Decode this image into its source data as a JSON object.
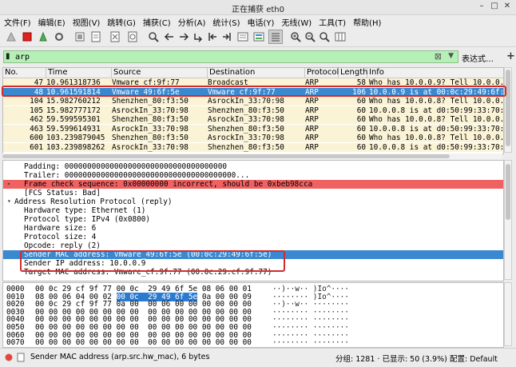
{
  "window": {
    "title": "正在捕获 eth0",
    "min": "–",
    "max": "□",
    "close": "✕"
  },
  "menu": [
    "文件(F)",
    "编辑(E)",
    "视图(V)",
    "跳转(G)",
    "捕获(C)",
    "分析(A)",
    "统计(S)",
    "电话(Y)",
    "无线(W)",
    "工具(T)",
    "帮助(H)"
  ],
  "toolbar_icons": [
    "shark-fin-icon",
    "stop-icon",
    "restart-icon",
    "options-gear-icon",
    "open-folder-icon",
    "save-file-icon",
    "close-file-icon",
    "reload-icon",
    "find-icon",
    "back-arrow-icon",
    "forward-arrow-icon",
    "goto-packet-icon",
    "first-packet-icon",
    "last-packet-icon",
    "autoscroll-icon",
    "colorize-icon",
    "zoom-in-icon",
    "zoom-out-icon",
    "zoom-normal-icon",
    "resize-columns-icon"
  ],
  "filter": {
    "value": "arp",
    "expression_label": "表达式…",
    "plus": "+"
  },
  "packet_list": {
    "columns": [
      "No.",
      "Time",
      "Source",
      "Destination",
      "Protocol",
      "Length",
      "Info"
    ],
    "rows": [
      {
        "no": "47",
        "time": "10.961318736",
        "src": "Vmware_cf:9f:77",
        "dst": "Broadcast",
        "proto": "ARP",
        "len": "58",
        "info": "Who has 10.0.0.9? Tell 10.0.0.",
        "style": "normal"
      },
      {
        "no": "48",
        "time": "10.961591814",
        "src": "Vmware_49:6f:5e",
        "dst": "Vmware_cf:9f:77",
        "proto": "ARP",
        "len": "106",
        "info": "10.0.0.9 is at 00:0c:29:49:6f:",
        "style": "selected"
      },
      {
        "no": "104",
        "time": "15.982760212",
        "src": "Shenzhen_80:f3:50",
        "dst": "AsrockIn_33:70:98",
        "proto": "ARP",
        "len": "60",
        "info": "Who has 10.0.0.8? Tell 10.0.0.",
        "style": "normal"
      },
      {
        "no": "105",
        "time": "15.982777172",
        "src": "AsrockIn_33:70:98",
        "dst": "Shenzhen_80:f3:50",
        "proto": "ARP",
        "len": "60",
        "info": "10.0.0.8 is at d0:50:99:33:70:",
        "style": "normal"
      },
      {
        "no": "462",
        "time": "59.599595301",
        "src": "Shenzhen_80:f3:50",
        "dst": "AsrockIn_33:70:98",
        "proto": "ARP",
        "len": "60",
        "info": "Who has 10.0.0.8? Tell 10.0.0.",
        "style": "normal"
      },
      {
        "no": "463",
        "time": "59.599614931",
        "src": "AsrockIn_33:70:98",
        "dst": "Shenzhen_80:f3:50",
        "proto": "ARP",
        "len": "60",
        "info": "10.0.0.8 is at d0:50:99:33:70:",
        "style": "normal"
      },
      {
        "no": "600",
        "time": "103.239879045",
        "src": "Shenzhen_80:f3:50",
        "dst": "AsrockIn_33:70:98",
        "proto": "ARP",
        "len": "60",
        "info": "Who has 10.0.0.8? Tell 10.0.0.",
        "style": "normal"
      },
      {
        "no": "601",
        "time": "103.239898262",
        "src": "AsrockIn_33:70:98",
        "dst": "Shenzhen_80:f3:50",
        "proto": "ARP",
        "len": "60",
        "info": "10.0.0.8 is at d0:50:99:33:70:",
        "style": "normal"
      }
    ]
  },
  "details": [
    {
      "text": "Padding: 000000000000000000000000000000000000",
      "indent": 1,
      "style": "normal"
    },
    {
      "text": "Trailer: 00000000000000000000000000000000000000...",
      "indent": 1,
      "style": "normal"
    },
    {
      "text": "Frame check sequence: 0x00000000 incorrect, should be 0xbeb98cca",
      "indent": 1,
      "style": "error",
      "arrow": "▸"
    },
    {
      "text": "[FCS Status: Bad]",
      "indent": 1,
      "style": "normal"
    },
    {
      "text": "Address Resolution Protocol (reply)",
      "indent": 0,
      "style": "normal",
      "arrow": "▾"
    },
    {
      "text": "Hardware type: Ethernet (1)",
      "indent": 1,
      "style": "normal"
    },
    {
      "text": "Protocol type: IPv4 (0x0800)",
      "indent": 1,
      "style": "normal"
    },
    {
      "text": "Hardware size: 6",
      "indent": 1,
      "style": "normal"
    },
    {
      "text": "Protocol size: 4",
      "indent": 1,
      "style": "normal"
    },
    {
      "text": "Opcode: reply (2)",
      "indent": 1,
      "style": "normal"
    },
    {
      "text": "Sender MAC address: Vmware_49:6f:5e (00:0c:29:49:6f:5e)",
      "indent": 1,
      "style": "selected"
    },
    {
      "text": "Sender IP address: 10.0.0.9",
      "indent": 1,
      "style": "normal"
    },
    {
      "text": "Target MAC address: Vmware_cf:9f:77 (00:0c:29:cf:9f:77)",
      "indent": 1,
      "style": "normal"
    }
  ],
  "hex": [
    {
      "off": "0000",
      "pre": "00 0c 29 cf 9f 77 00 0c  29 49 6f 5e 08 06 00 01",
      "hl": "",
      "post": "",
      "ascii": "··)··w·· )Io^····"
    },
    {
      "off": "0010",
      "pre": "08 00 06 04 00 02 ",
      "hl": "00 0c  29 49 6f 5e",
      "post": " 0a 00 00 09",
      "ascii": "········ )Io^····"
    },
    {
      "off": "0020",
      "pre": "00 0c 29 cf 9f 77 0a 00  00 06 00 00 00 00 00 00",
      "hl": "",
      "post": "",
      "ascii": "··)··w·· ········"
    },
    {
      "off": "0030",
      "pre": "00 00 00 00 00 00 00 00  00 00 00 00 00 00 00 00",
      "hl": "",
      "post": "",
      "ascii": "········ ········"
    },
    {
      "off": "0040",
      "pre": "00 00 00 00 00 00 00 00  00 00 00 00 00 00 00 00",
      "hl": "",
      "post": "",
      "ascii": "········ ········"
    },
    {
      "off": "0050",
      "pre": "00 00 00 00 00 00 00 00  00 00 00 00 00 00 00 00",
      "hl": "",
      "post": "",
      "ascii": "········ ········"
    },
    {
      "off": "0060",
      "pre": "00 00 00 00 00 00 00 00  00 00 00 00 00 00 00 00",
      "hl": "",
      "post": "",
      "ascii": "········ ········"
    },
    {
      "off": "0070",
      "pre": "00 00 00 00 00 00 00 00  00 00 00 00 00 00 00 00",
      "hl": "",
      "post": "",
      "ascii": "········ ········"
    }
  ],
  "status": {
    "field": "Sender MAC address (arp.src.hw_mac), 6 bytes",
    "counts": "分组: 1281 · 已显示: 50 (3.9%)",
    "profile": "配置: Default"
  },
  "colors": {
    "arp_row": "#fbf3d6",
    "selected": "#3a88d0",
    "error": "#f06262",
    "highlight_box": "#d12b2b",
    "filter_ok": "#b6f0b6"
  }
}
